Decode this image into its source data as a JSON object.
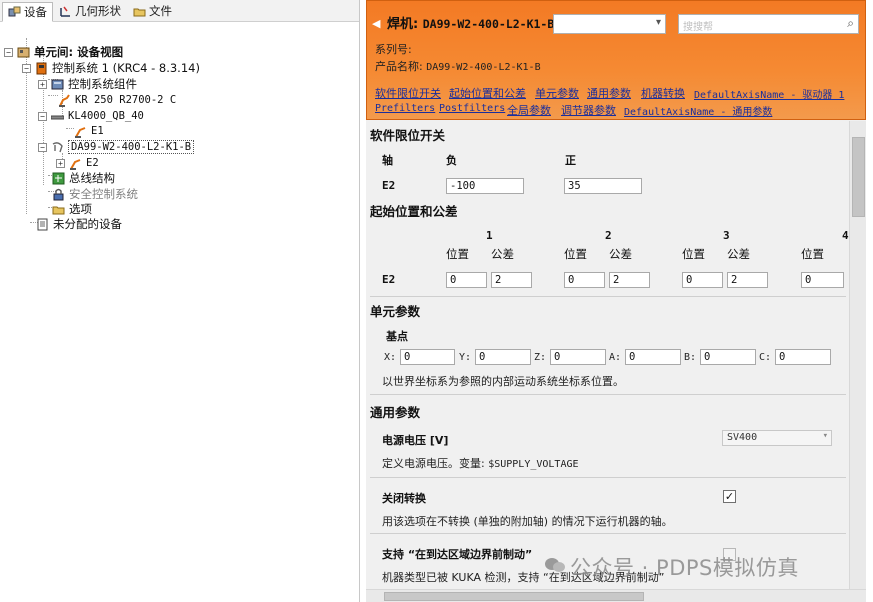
{
  "left_tabs": [
    {
      "label": "设备",
      "icon": "devices-icon"
    },
    {
      "label": "几何形状",
      "icon": "geometry-icon"
    },
    {
      "label": "文件",
      "icon": "files-icon"
    }
  ],
  "tree": {
    "root": {
      "label": "单元间: 设备视图"
    },
    "controller": {
      "label": "控制系统 1 (KRC4 - 8.3.14)"
    },
    "components": {
      "label": "控制系统组件"
    },
    "robot": {
      "label": "KR 250 R2700-2 C"
    },
    "track": {
      "label": "KL4000_QB_40"
    },
    "track_axis": {
      "label": "E1"
    },
    "gun": {
      "label": "DA99-W2-400-L2-K1-B"
    },
    "gun_axis": {
      "label": "E2"
    },
    "bus": {
      "label": "总线结构"
    },
    "safety": {
      "label": "安全控制系统"
    },
    "options": {
      "label": "选项"
    },
    "unassigned": {
      "label": "未分配的设备"
    }
  },
  "header": {
    "back_glyph": "◀",
    "title_prefix": "焊机: ",
    "title_name": "DA99-W2-400-L2-K1-B",
    "search_placeholder": "搜搜帮",
    "serial_label": "系列号:",
    "product_label": "产品名称: ",
    "product_value": "DA99-W2-400-L2-K1-B",
    "nav_links": [
      "软件限位开关",
      "起始位置和公差",
      "单元参数",
      "通用参数",
      "机器转换",
      "DefaultAxisName - 驱动器 1",
      "Prefilters",
      "Postfilters",
      "全局参数",
      "调节器参数",
      "DefaultAxisName - 通用参数"
    ]
  },
  "sw_limits": {
    "title": "软件限位开关",
    "col_axis": "轴",
    "col_neg": "负",
    "col_pos": "正",
    "axis": "E2",
    "neg_value": "-100",
    "pos_value": "35"
  },
  "home_pos": {
    "title": "起始位置和公差",
    "axis": "E2",
    "pos_label": "位置",
    "tol_label": "公差",
    "groups": [
      {
        "index": "1",
        "position": "0",
        "tolerance": "2"
      },
      {
        "index": "2",
        "position": "0",
        "tolerance": "2"
      },
      {
        "index": "3",
        "position": "0",
        "tolerance": "2"
      },
      {
        "index": "4",
        "position": "0",
        "tolerance": ""
      }
    ]
  },
  "unit_params": {
    "title": "单元参数",
    "base_label": "基点",
    "coords": [
      {
        "label": "X:",
        "value": "0"
      },
      {
        "label": "Y:",
        "value": "0"
      },
      {
        "label": "Z:",
        "value": "0"
      },
      {
        "label": "A:",
        "value": "0"
      },
      {
        "label": "B:",
        "value": "0"
      },
      {
        "label": "C:",
        "value": "0"
      }
    ],
    "desc": "以世界坐标系为参照的内部运动系统坐标系位置。"
  },
  "general": {
    "title": "通用参数",
    "voltage_label": "电源电压 [V]",
    "voltage_value": "SV400",
    "voltage_desc_prefix": "定义电源电压。变量: ",
    "voltage_desc_var": "$SUPPLY_VOLTAGE",
    "shutdown_label": "关闭转换",
    "shutdown_checked": true,
    "shutdown_desc": "用该选项在不转换 (单独的附加轴) 的情况下运行机器的轴。",
    "brake_label": "支持 “在到达区域边界前制动”",
    "brake_desc": "机器类型已被 KUKA 检测，支持 “在到达区域边界前制动”"
  },
  "watermark": {
    "text": "公众号 · PDPS模拟仿真"
  },
  "colors": {
    "header_orange": "#f58a33",
    "link_blue": "#1a2e9c"
  }
}
